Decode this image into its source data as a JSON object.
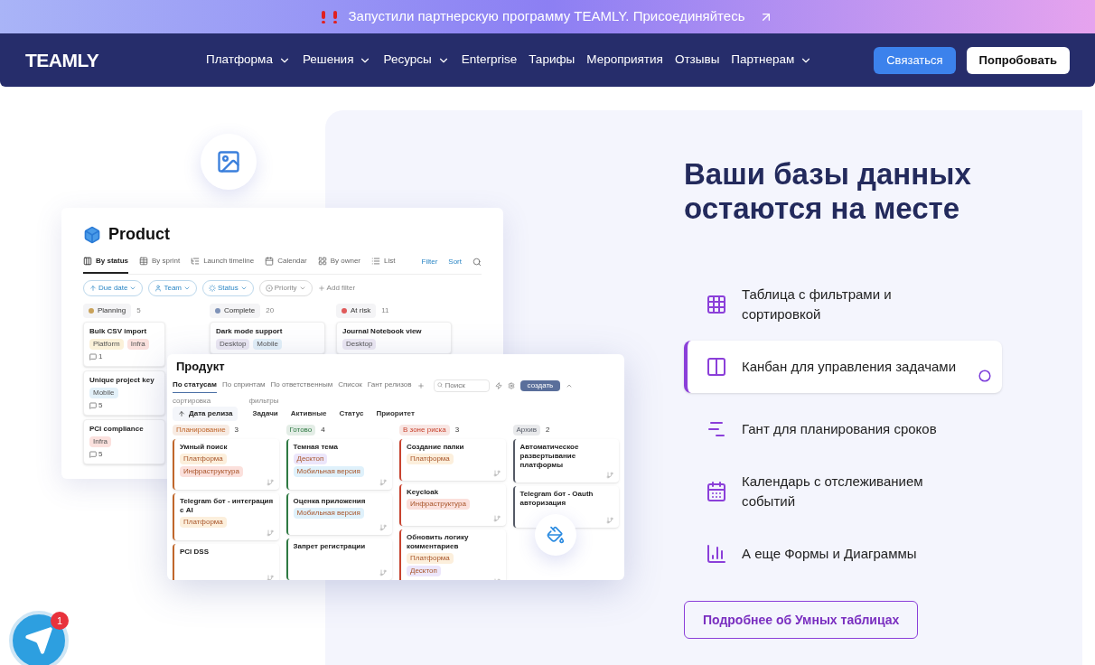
{
  "announcement": {
    "text": "Запустили партнерскую программу TEAMLY. Присоединяйтесь"
  },
  "nav": {
    "logo": "TEAMLY",
    "items": [
      {
        "label": "Платформа",
        "dropdown": true
      },
      {
        "label": "Решения",
        "dropdown": true
      },
      {
        "label": "Ресурсы",
        "dropdown": true
      },
      {
        "label": "Enterprise",
        "dropdown": false
      },
      {
        "label": "Тарифы",
        "dropdown": false
      },
      {
        "label": "Мероприятия",
        "dropdown": false
      },
      {
        "label": "Отзывы",
        "dropdown": false
      },
      {
        "label": "Партнерам",
        "dropdown": true
      }
    ],
    "contact": "Связаться",
    "try": "Попробовать"
  },
  "mockup_en": {
    "title": "Product",
    "views": [
      {
        "label": "By status",
        "kind": "board",
        "selected": true
      },
      {
        "label": "By sprint",
        "kind": "table",
        "selected": false
      },
      {
        "label": "Launch timeline",
        "kind": "timeline",
        "selected": false
      },
      {
        "label": "Calendar",
        "kind": "calendar",
        "selected": false
      },
      {
        "label": "By owner",
        "kind": "grid",
        "selected": false
      },
      {
        "label": "List",
        "kind": "list",
        "selected": false
      }
    ],
    "filter": "Filter",
    "sort": "Sort",
    "chips": [
      {
        "label": "Due date",
        "kind": "sort"
      },
      {
        "label": "Team",
        "kind": "person"
      },
      {
        "label": "Status",
        "kind": "status"
      },
      {
        "label": "Priority",
        "kind": "priority"
      }
    ],
    "add_filter": "Add filter",
    "columns": [
      {
        "label": "Planning",
        "count": "5",
        "color": "#c9a25a",
        "cards": [
          {
            "title": "Bulk CSV import",
            "tags": [
              {
                "label": "Platform",
                "color": "#fbf1d9"
              },
              {
                "label": "Infra",
                "color": "#fbe1de"
              }
            ],
            "comments": "1"
          },
          {
            "title": "Unique project key",
            "tags": [
              {
                "label": "Mobile",
                "color": "#e3f1f9"
              }
            ],
            "comments": "5"
          },
          {
            "title": "PCI compliance",
            "tags": [
              {
                "label": "Infra",
                "color": "#fbe1de"
              }
            ],
            "comments": "5"
          }
        ]
      },
      {
        "label": "Complete",
        "count": "20",
        "color": "#7f93b8",
        "cards": [
          {
            "title": "Dark mode support",
            "tags": [
              {
                "label": "Desktop",
                "color": "#ece8f3"
              },
              {
                "label": "Mobile",
                "color": "#e3f1f9"
              }
            ]
          }
        ]
      },
      {
        "label": "At risk",
        "count": "11",
        "color": "#e05a5a",
        "cards": [
          {
            "title": "Journal Notebook view",
            "tags": [
              {
                "label": "Desktop",
                "color": "#ece8f3"
              }
            ]
          }
        ]
      }
    ]
  },
  "mockup_ru": {
    "title": "Продукт",
    "views": [
      {
        "label": "По статусам",
        "selected": true
      },
      {
        "label": "По спринтам",
        "selected": false
      },
      {
        "label": "По ответственным",
        "selected": false
      },
      {
        "label": "Список",
        "selected": false
      },
      {
        "label": "Гант релизов",
        "selected": false
      }
    ],
    "search_placeholder": "Поиск",
    "create": "создать",
    "sort_label": "сортировка",
    "sort": "Дата релиза",
    "filters_label": "фильтры",
    "filters": [
      "Задачи",
      "Активные",
      "Статус",
      "Приоритет"
    ],
    "columns": [
      {
        "label": "Планирование",
        "count": "3",
        "color": "#c0662b",
        "cards": [
          {
            "title": "Умный поиск",
            "tags": [
              {
                "label": "Платформа",
                "color": "#fcefdc"
              },
              {
                "label": "Инфраструктура",
                "color": "#fbe0dc"
              }
            ]
          },
          {
            "title": "Telegram бот - интеграция с AI",
            "tags": [
              {
                "label": "Платформа",
                "color": "#fcefdc"
              }
            ]
          },
          {
            "title": "PCI DSS"
          }
        ]
      },
      {
        "label": "Готово",
        "count": "4",
        "color": "#2f7a43",
        "cards": [
          {
            "title": "Темная тема",
            "tags": [
              {
                "label": "Десктоп",
                "color": "#ece6fb"
              },
              {
                "label": "Мобильная версия",
                "color": "#dff1fb"
              }
            ]
          },
          {
            "title": "Оценка приложения",
            "tags": [
              {
                "label": "Мобильная версия",
                "color": "#dff1fb"
              }
            ]
          },
          {
            "title": "Запрет регистрации"
          }
        ]
      },
      {
        "label": "В зоне риска",
        "count": "3",
        "color": "#c8432f",
        "cards": [
          {
            "title": "Создание папки",
            "tags": [
              {
                "label": "Платформа",
                "color": "#fcefdc"
              }
            ]
          },
          {
            "title": "Keycloak",
            "tags": [
              {
                "label": "Инфраструктура",
                "color": "#fbe0dc"
              }
            ]
          },
          {
            "title": "Обновить логику комментариев",
            "tags": [
              {
                "label": "Платформа",
                "color": "#fcefdc"
              },
              {
                "label": "Десктоп",
                "color": "#ece6fb"
              }
            ]
          }
        ]
      },
      {
        "label": "Архив",
        "count": "2",
        "color": "#555a66",
        "cards": [
          {
            "title": "Автоматическое развертывание платформы"
          },
          {
            "title": "Telegram бот - Oauth авторизация"
          }
        ]
      }
    ]
  },
  "hero": {
    "heading": "Ваши базы данных остаются на месте",
    "features": [
      {
        "kind": "table",
        "label": "Таблица с фильтрами и сортировкой",
        "selected": false
      },
      {
        "kind": "kanban",
        "label": "Канбан для управления задачами",
        "selected": true
      },
      {
        "kind": "gantt",
        "label": "Гант для планирования сроков",
        "selected": false
      },
      {
        "kind": "calendar",
        "label": "Календарь с отслеживанием событий",
        "selected": false
      },
      {
        "kind": "charts",
        "label": "А еще Формы и Диаграммы",
        "selected": false
      }
    ],
    "more": "Подробнее об Умных таблицах"
  },
  "chat": {
    "badge": "1"
  }
}
